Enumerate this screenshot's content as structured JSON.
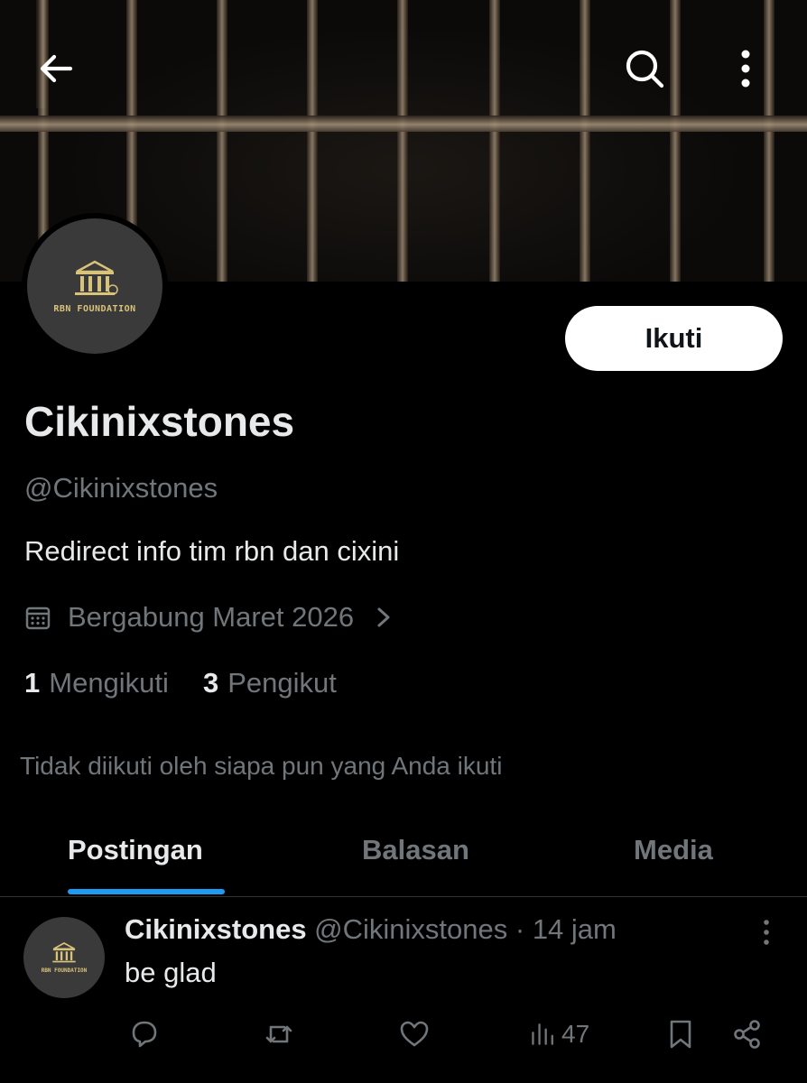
{
  "header": {
    "back_icon": "arrow-left-icon",
    "search_icon": "search-icon",
    "more_icon": "more-vertical-icon"
  },
  "profile": {
    "avatar_text": "RBN FOUNDATION",
    "follow_label": "Ikuti",
    "display_name": "Cikinixstones",
    "handle": "@Cikinixstones",
    "bio": "Redirect info tim rbn dan cixini",
    "joined": "Bergabung Maret 2026",
    "following_count": "1",
    "following_label": "Mengikuti",
    "followers_count": "3",
    "followers_label": "Pengikut",
    "not_followed_text": "Tidak diikuti oleh siapa pun yang Anda ikuti"
  },
  "tabs": [
    {
      "label": "Postingan",
      "active": true
    },
    {
      "label": "Balasan",
      "active": false
    },
    {
      "label": "Media",
      "active": false
    }
  ],
  "post": {
    "avatar_text": "RBN FOUNDATION",
    "name": "Cikinixstones",
    "meta": " @Cikinixstones · 14 jam",
    "text": "be glad",
    "views": "47"
  },
  "colors": {
    "accent": "#1d9bf0",
    "muted": "#71767b",
    "text": "#e7e9ea",
    "background": "#000000"
  }
}
